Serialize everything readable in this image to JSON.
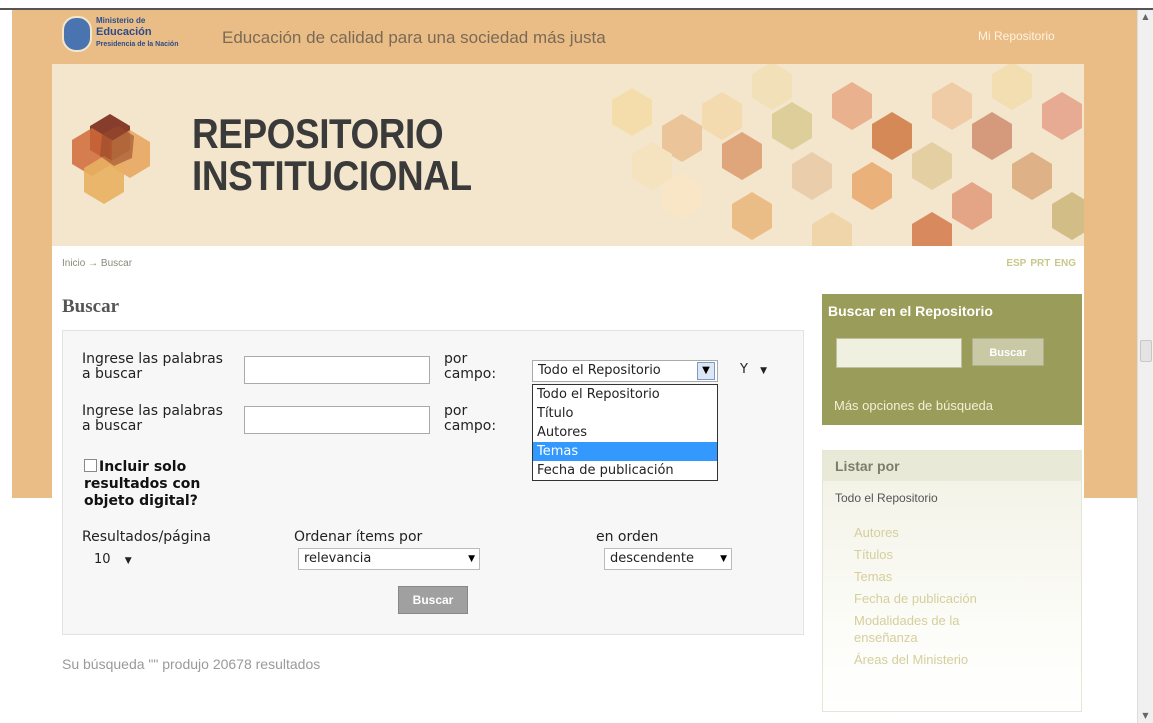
{
  "header": {
    "logo_lines": [
      "Ministerio de",
      "Educación",
      "Presidencia de la Nación"
    ],
    "tagline": "Educación de calidad para una sociedad más justa",
    "mi_repositorio": "Mi Repositorio"
  },
  "banner": {
    "title_line1": "REPOSITORIO",
    "title_line2": "INSTITUCIONAL"
  },
  "breadcrumb": {
    "home": "Inicio",
    "arrow": "→",
    "current": "Buscar"
  },
  "languages": [
    "ESP",
    "PRT",
    "ENG"
  ],
  "search": {
    "heading": "Buscar",
    "row1": {
      "label": "Ingrese las palabras a buscar",
      "value": "",
      "field_label": "por campo:",
      "field_value": "Todo el Repositorio",
      "conjunction": "Y"
    },
    "row2": {
      "label": "Ingrese las palabras a buscar",
      "value": "",
      "field_label": "por campo:"
    },
    "dropdown_options": [
      "Todo el Repositorio",
      "Título",
      "Autores",
      "Temas",
      "Fecha de publicación"
    ],
    "highlighted_option": "Temas",
    "digital_only_label": "Incluir solo resultados con objeto digital?",
    "results_per_page_label": "Resultados/página",
    "results_per_page_value": "10",
    "sort_label": "Ordenar ítems por",
    "sort_value": "relevancia",
    "order_label": "en orden",
    "order_value": "descendente",
    "submit": "Buscar",
    "summary": "Su búsqueda \"\" produjo 20678 resultados"
  },
  "sidebar": {
    "search_title": "Buscar en el Repositorio",
    "search_button": "Buscar",
    "more_options": "Más opciones de búsqueda",
    "browse_title": "Listar por",
    "browse_scope": "Todo el Repositorio",
    "browse_items": [
      "Autores",
      "Títulos",
      "Temas",
      "Fecha de publicación",
      "Modalidades de la enseñanza",
      "Áreas del Ministerio"
    ]
  },
  "colors": {
    "band": "#eabd86",
    "sidebar_search": "#9a9d5a",
    "highlight": "#3399ff",
    "link_muted": "#d5cf9c"
  }
}
